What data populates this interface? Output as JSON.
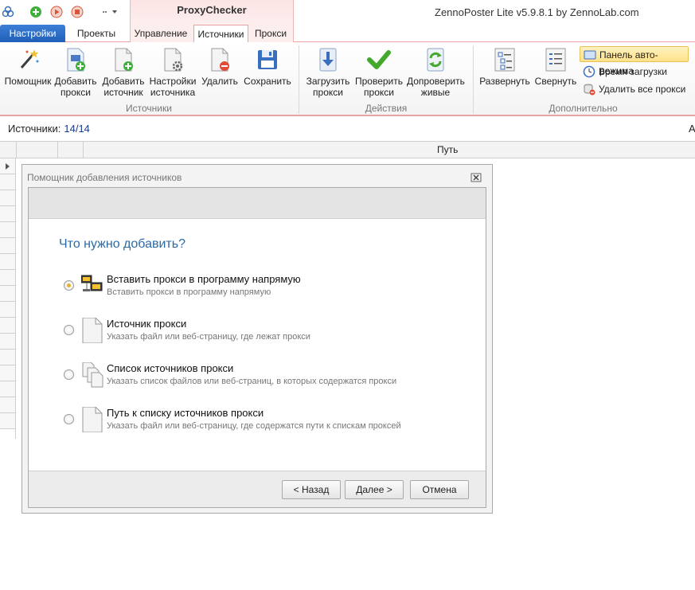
{
  "app": {
    "context_tab_title": "ProxyChecker",
    "title": "ZennoPoster Lite v5.9.8.1 by ZennoLab.com"
  },
  "tabs": [
    {
      "label": "Настройки"
    },
    {
      "label": "Проекты"
    },
    {
      "label": "Управление"
    },
    {
      "label": "Источники"
    },
    {
      "label": "Прокси"
    }
  ],
  "ribbon": {
    "groups": {
      "sources": "Источники",
      "actions": "Действия",
      "additional": "Дополнительно"
    },
    "buttons": {
      "wizard": "Помощник",
      "add_proxy": [
        "Добавить",
        "прокси"
      ],
      "add_source": [
        "Добавить",
        "источник"
      ],
      "source_settings": [
        "Настройки",
        "источника"
      ],
      "delete": "Удалить",
      "save": "Сохранить",
      "load_proxy": [
        "Загрузить",
        "прокси"
      ],
      "check_proxy": [
        "Проверить",
        "прокси"
      ],
      "recheck_alive": [
        "Допроверить",
        "живые"
      ],
      "expand": "Развернуть",
      "collapse": "Свернуть"
    },
    "small_buttons": {
      "auto_panel": "Панель авто-режима",
      "load_time": "Время загрузки",
      "delete_all_proxies": "Удалить все прокси"
    }
  },
  "sources": {
    "label": "Источники:",
    "count": "14/14",
    "cut_letter": "А"
  },
  "grid": {
    "path_header": "Путь"
  },
  "dialog": {
    "title": "Помощник добавления источников",
    "question": "Что нужно добавить?",
    "options": [
      {
        "title": "Вставить прокси в программу напрямую",
        "desc": "Вставить прокси в программу напрямую",
        "selected": true
      },
      {
        "title": "Источник прокси",
        "desc": "Указать файл или веб-страницу, где лежат прокси",
        "selected": false
      },
      {
        "title": "Список источников прокси",
        "desc": "Указать список файлов или веб-страниц, в которых содержатся прокси",
        "selected": false
      },
      {
        "title": "Путь к списку источников прокси",
        "desc": "Указать файл или веб-страницу, где содержатся пути к спискам проксей",
        "selected": false
      }
    ],
    "buttons": {
      "back": "< Назад",
      "next": "Далее >",
      "cancel": "Отмена"
    }
  },
  "colors": {
    "accent_blue": "#1f5fb8",
    "context_pink": "#fdeeee",
    "question_blue": "#2b6aa8",
    "radio_selected": "#e0b331"
  }
}
